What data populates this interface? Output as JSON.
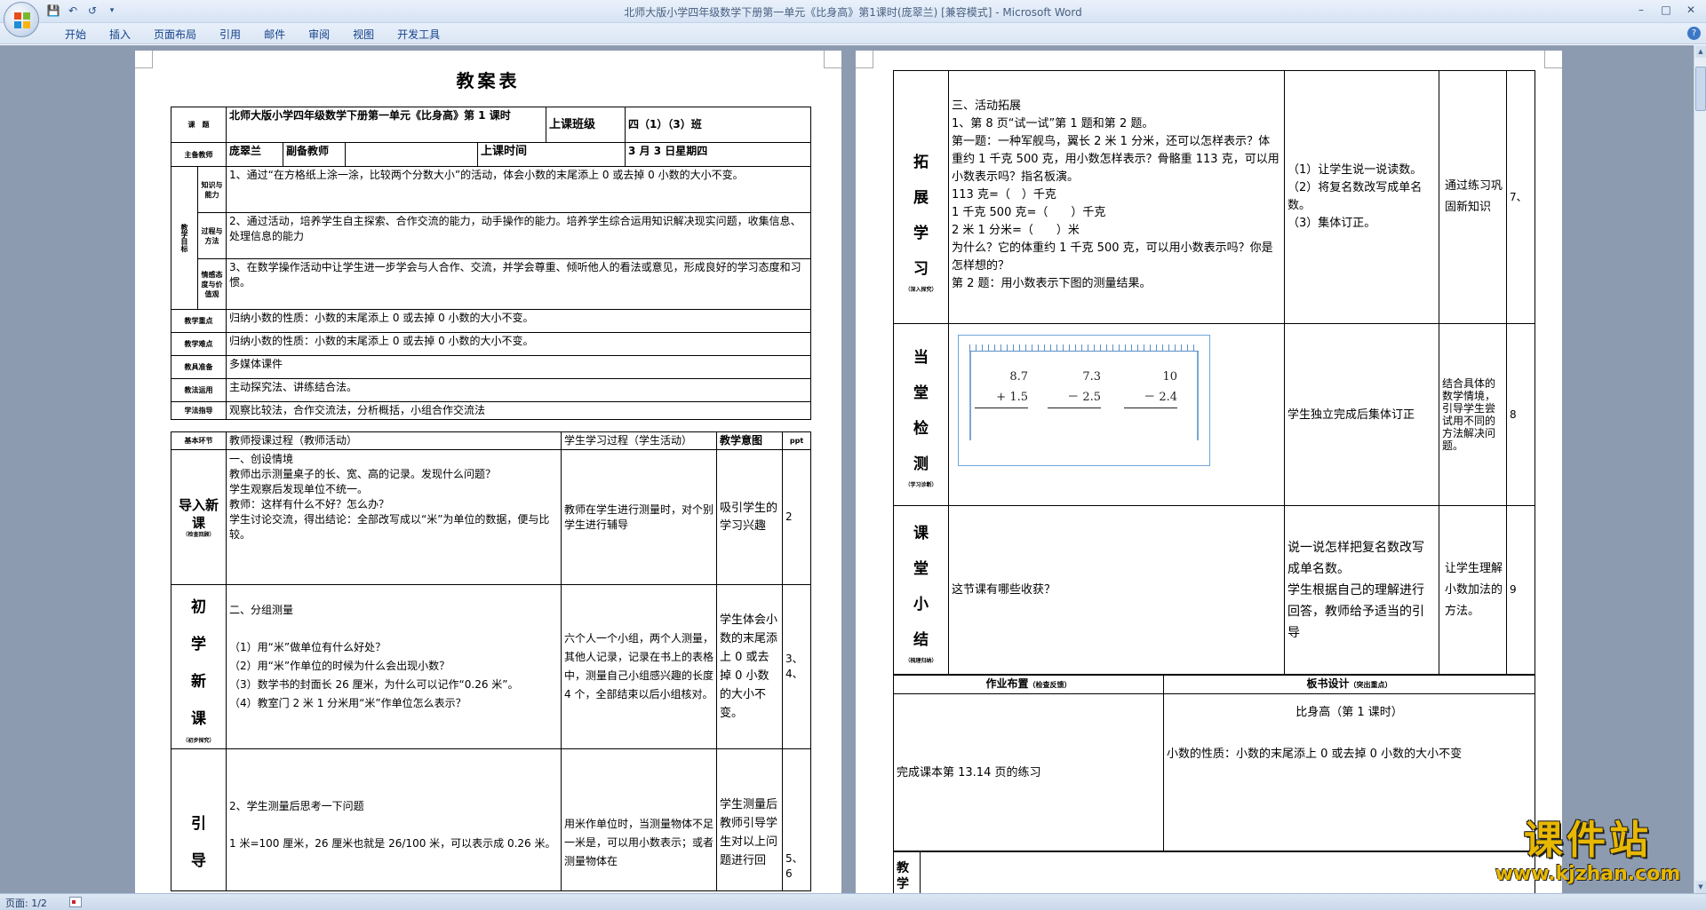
{
  "window": {
    "title": "北师大版小学四年级数学下册第一单元《比身高》第1课时(庞翠兰) [兼容模式] - Microsoft Word"
  },
  "ribbon": {
    "tabs": [
      "开始",
      "插入",
      "页面布局",
      "引用",
      "邮件",
      "审阅",
      "视图",
      "开发工具"
    ]
  },
  "qat": {
    "save_icon": "save-icon",
    "undo_icon": "undo-icon",
    "redo_icon": "redo-icon",
    "customize_icon": "chevron-down-icon"
  },
  "status": {
    "page": "页面: 1/2"
  },
  "colors": {
    "workspace": "#8d9bb0",
    "ribbon": "#dbe6f4",
    "title_text": "#4a5f80",
    "tab_text": "#15428b"
  },
  "page1": {
    "title": "教案表",
    "r_topic_label": "课　题",
    "r_topic": "北师大版小学四年级数学下册第一单元《比身高》第 1 课时",
    "r_class_label": "上课班级",
    "r_class": "四（1）（3）班",
    "r_teacher_label": "主备教师",
    "r_teacher": "庞翠兰",
    "r_coteacher_label": "副备教师",
    "r_time_label": "上课时间",
    "r_time": "3 月 3 日星期四",
    "goal_label": "教学目标",
    "g1_label": "知识与能力",
    "g1": "1、通过“在方格纸上涂一涂，比较两个分数大小”的活动，体会小数的末尾添上 0 或去掉 0 小数的大小不变。",
    "g2_label": "过程与方法",
    "g2": "2、通过活动，培养学生自主探索、合作交流的能力，动手操作的能力。培养学生综合运用知识解决现实问题，收集信息、处理信息的能力",
    "g3_label": "情感态度与价值观",
    "g3": "3、在数学操作活动中让学生进一步学会与人合作、交流，并学会尊重、倾听他人的看法或意见，形成良好的学习态度和习惯。",
    "key_label": "教学重点",
    "key": "归纳小数的性质：小数的末尾添上 0 或去掉 0 小数的大小不变。",
    "diff_label": "教学难点",
    "diff": "归纳小数的性质：小数的末尾添上 0 或去掉 0 小数的大小不变。",
    "prep_label": "教具准备",
    "prep": "多媒体课件",
    "method_label": "教法运用",
    "method": "主动探究法、讲练结合法。",
    "study_label": "学法指导",
    "study": "观察比较法，合作交流法，分析概括，小组合作交流法",
    "h_stage": "基本环节",
    "h_teacher": "教师授课过程（教师活动）",
    "h_student": "学生学习过程（学生活动）",
    "h_intent": "教学意图",
    "h_ppt": "ppt",
    "s1_label": "导入新课",
    "s1_sub": "（检查回顾）",
    "s1_teacher": "一、创设情境\n教师出示测量桌子的长、宽、高的记录。发现什么问题？\n学生观察后发现单位不统一。\n教师：这样有什么不好？怎么办？\n学生讨论交流，得出结论：全部改写成以“米”为单位的数据，便与比较。",
    "s1_student": "教师在学生进行测量时，对个别学生进行辅导",
    "s1_intent": "吸引学生的学习兴趣",
    "s1_ppt": "2",
    "s2_label": "初学新课",
    "s2_sub": "（初步探究）",
    "s2_teacher": "二、分组测量\n\n（1）用“米”做单位有什么好处？\n（2）用“米”作单位的时候为什么会出现小数？\n（3）数学书的封面长 26 厘米，为什么可以记作“0.26 米”。\n（4）教室门 2 米 1 分米用“米”作单位怎么表示？",
    "s2_student": "六个人一个小组，两个人测量，其他人记录，记录在书上的表格中，测量自己小组感兴趣的长度 4 个，全部结束以后小组核对。",
    "s2_intent": "学生体会小数的末尾添上 0 或去掉 0 小数的大小不变。",
    "s2_ppt": "3、4、",
    "s3_label": "引导",
    "s3_teacher": "2、学生测量后思考一下问题\n\n1 米=100 厘米，26 厘米也就是 26/100 米，可以表示成 0.26 米。",
    "s3_student": "用米作单位时，当测量物体不足一米是，可以用小数表示；或者测量物体在",
    "s3_intent": "学生测量后教师引导学生对以上问题进行回",
    "s3_ppt": "5、6"
  },
  "page2": {
    "e_label": "拓展学习",
    "e_sub": "（深入探究）",
    "e_content": "三、活动拓展\n1、第 8 页“试一试”第 1 题和第 2 题。\n第一题：一种军舰鸟，翼长 2 米 1 分米，还可以怎样表示？体重约 1 千克 500 克，用小数怎样表示？骨骼重 113 克，可以用小数表示吗？指名板演。\n113 克=（　）千克\n1 千克 500 克=（　　）千克\n2 米 1 分米=（　　）米\n为什么？它的体重约 1 千克 500 克，可以用小数表示吗？你是怎样想的？\n第 2 题：用小数表示下图的测量结果。",
    "e_student": "（1）让学生说一说读数。\n（2）将复名数改写成单名数。\n（3）集体订正。",
    "e_intent": "通过练习巩固新知识",
    "e_ppt": "7、",
    "c_label": "当堂检测",
    "c_sub": "（学习诊断）",
    "c_prob1_top": "8.7",
    "c_prob1_bot": "+ 1.5",
    "c_prob2_top": "7.3",
    "c_prob2_bot": "－ 2.5",
    "c_prob3_top": "10",
    "c_prob3_bot": "－ 2.4",
    "c_student": "学生独立完成后集体订正",
    "c_intent": "结合具体的数学情境，引导学生尝试用不同的方法解决问题。",
    "c_ppt": "8",
    "sum_label": "课堂小结",
    "sum_sub": "（梳理归纳）",
    "sum_content": "这节课有哪些收获？",
    "sum_student": "说一说怎样把复名数改写成单名数。\n学生根据自己的理解进行回答，教师给予适当的引导",
    "sum_intent": "让学生理解小数加法的方法。",
    "sum_ppt": "9",
    "hw_label": "作业布置",
    "hw_sub": "（检查反馈）",
    "bd_label": "板书设计",
    "bd_sub": "（突出重点）",
    "hw_content": "完成课本第 13.14 页的练习",
    "bd_title": "比身高（第 1 课时）",
    "bd_content": "小数的性质：小数的末尾添上 0 或去掉 0 小数的大小不变",
    "bottom_label": "教学"
  },
  "watermark": {
    "line1": "课件站",
    "line2": "www.kjzhan.com"
  }
}
